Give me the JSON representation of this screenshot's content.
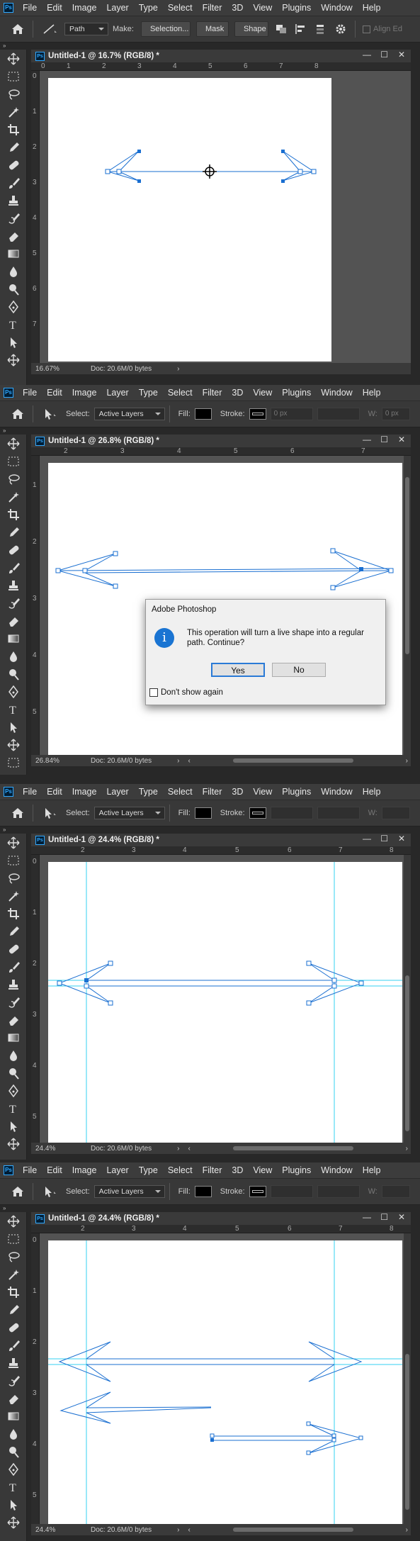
{
  "menu": [
    "File",
    "Edit",
    "Image",
    "Layer",
    "Type",
    "Select",
    "Filter",
    "3D",
    "View",
    "Plugins",
    "Window",
    "Help"
  ],
  "ps_logo": "Ps",
  "panel1": {
    "options": {
      "mode": "Path",
      "make_label": "Make:",
      "selection_btn": "Selection...",
      "mask_btn": "Mask",
      "shape_btn": "Shape",
      "align_edges": "Align Ed"
    },
    "doc_title": "Untitled-1 @ 16.7% (RGB/8) *",
    "zoom": "16.67%",
    "doc_info": "Doc: 20.6M/0 bytes",
    "ruler_top": [
      "0",
      "1",
      "2",
      "3",
      "4",
      "5",
      "6",
      "7",
      "8"
    ],
    "ruler_left": [
      "0",
      "1",
      "2",
      "3",
      "4",
      "5",
      "6",
      "7"
    ]
  },
  "panel2": {
    "options": {
      "select_label": "Select:",
      "select_value": "Active Layers",
      "fill_label": "Fill:",
      "stroke_label": "Stroke:",
      "stroke_width": "0 px",
      "w_label": "W:",
      "w_value": "0 px"
    },
    "doc_title": "Untitled-1 @ 26.8% (RGB/8) *",
    "zoom": "26.84%",
    "doc_info": "Doc: 20.6M/0 bytes",
    "ruler_top": [
      "2",
      "3",
      "4",
      "5",
      "6",
      "7"
    ],
    "ruler_left": [
      "1",
      "2",
      "3",
      "4",
      "5"
    ],
    "dialog": {
      "title": "Adobe Photoshop",
      "message_line1": "This operation will turn a live shape into a regular",
      "message_line2": "path. Continue?",
      "yes": "Yes",
      "no": "No",
      "checkbox": "Don't show again"
    }
  },
  "panel3": {
    "options": {
      "select_label": "Select:",
      "select_value": "Active Layers",
      "fill_label": "Fill:",
      "stroke_label": "Stroke:",
      "w_label": "W:"
    },
    "doc_title": "Untitled-1 @ 24.4% (RGB/8) *",
    "zoom": "24.4%",
    "doc_info": "Doc: 20.6M/0 bytes",
    "ruler_top": [
      "2",
      "3",
      "4",
      "5",
      "6",
      "7",
      "8"
    ],
    "ruler_left": [
      "0",
      "1",
      "2",
      "3",
      "4",
      "5"
    ]
  },
  "panel4": {
    "options": {
      "select_label": "Select:",
      "select_value": "Active Layers",
      "fill_label": "Fill:",
      "stroke_label": "Stroke:",
      "w_label": "W:"
    },
    "doc_title": "Untitled-1 @ 24.4% (RGB/8) *",
    "zoom": "24.4%",
    "doc_info": "Doc: 20.6M/0 bytes",
    "ruler_top": [
      "2",
      "3",
      "4",
      "5",
      "6",
      "7",
      "8"
    ],
    "ruler_left": [
      "0",
      "1",
      "2",
      "3",
      "4",
      "5"
    ]
  },
  "colors": {
    "path_blue": "#1a6fd1",
    "guide_cyan": "#35d0f0",
    "menubar": "#3c3c3c",
    "workspace": "#282828"
  },
  "toolbar_icons": [
    "move-tool",
    "marquee-tool",
    "lasso-tool",
    "magic-wand-tool",
    "crop-tool",
    "eyedropper-tool",
    "healing-brush-tool",
    "brush-tool",
    "clone-stamp-tool",
    "history-brush-tool",
    "eraser-tool",
    "gradient-tool",
    "blur-tool",
    "dodge-tool",
    "pen-tool",
    "type-tool",
    "path-selection-tool"
  ]
}
